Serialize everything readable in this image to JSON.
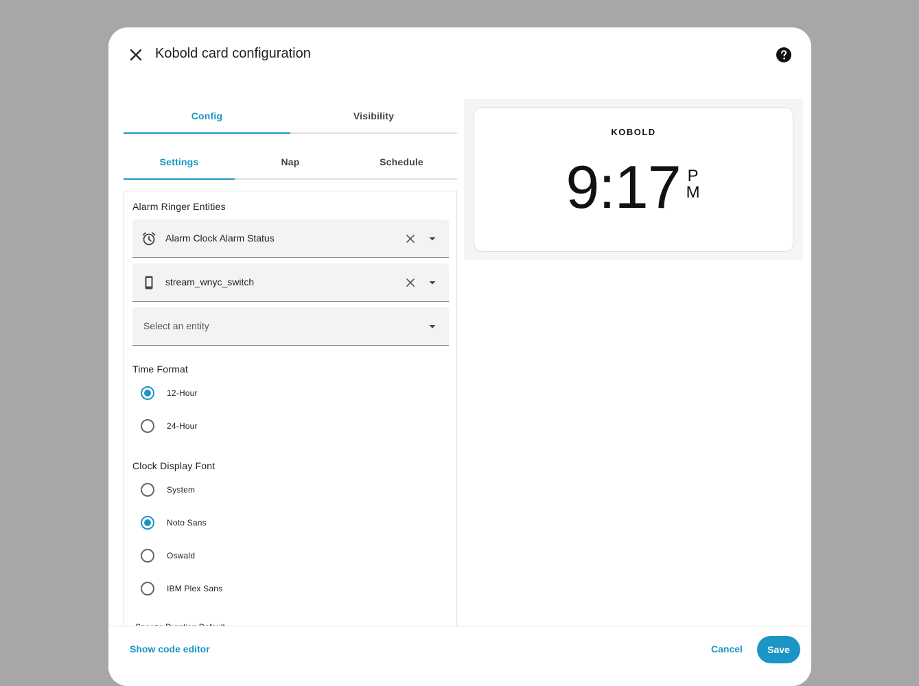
{
  "dialog": {
    "title": "Kobold card configuration",
    "close_icon": "close-icon",
    "help_icon": "help-circle-icon"
  },
  "tabs_primary": [
    {
      "label": "Config",
      "active": true
    },
    {
      "label": "Visibility",
      "active": false
    }
  ],
  "tabs_secondary": [
    {
      "label": "Settings",
      "active": true
    },
    {
      "label": "Nap",
      "active": false
    },
    {
      "label": "Schedule",
      "active": false
    }
  ],
  "alarm_ringer": {
    "label": "Alarm Ringer Entities",
    "entities": [
      {
        "icon": "alarm-clock-icon",
        "value": "Alarm Clock Alarm Status"
      },
      {
        "icon": "cellphone-icon",
        "value": "stream_wnyc_switch"
      }
    ],
    "empty_placeholder": "Select an entity"
  },
  "time_format": {
    "label": "Time Format",
    "options": [
      {
        "label": "12-Hour",
        "checked": true
      },
      {
        "label": "24-Hour",
        "checked": false
      }
    ]
  },
  "clock_font": {
    "label": "Clock Display Font",
    "options": [
      {
        "label": "System",
        "checked": false
      },
      {
        "label": "Noto Sans",
        "checked": true
      },
      {
        "label": "Oswald",
        "checked": false
      },
      {
        "label": "IBM Plex Sans",
        "checked": false
      }
    ]
  },
  "cut_off_label": "Snooze Duration Default",
  "preview": {
    "logo": "KOBOLD",
    "time": "9:17",
    "ampm_top": "P",
    "ampm_bottom": "M"
  },
  "footer": {
    "show_code": "Show code editor",
    "cancel": "Cancel",
    "save": "Save"
  },
  "colors": {
    "accent": "#1a95c5",
    "backdrop": "#a7a7a7"
  }
}
